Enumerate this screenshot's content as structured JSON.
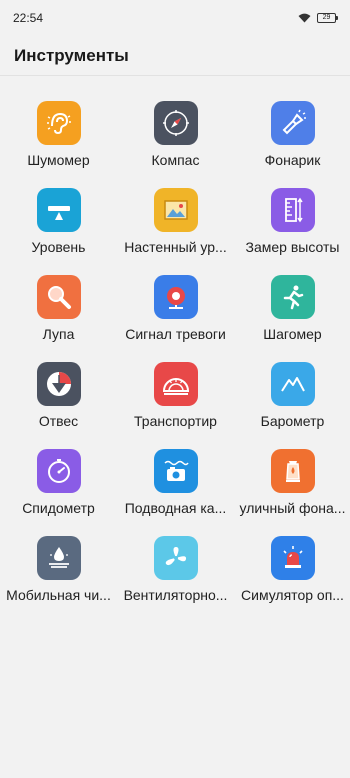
{
  "status_bar": {
    "time": "22:54",
    "battery": "29"
  },
  "header": {
    "title": "Инструменты"
  },
  "tools": [
    {
      "label": "Шумомер",
      "icon": "noise-meter-icon",
      "color": "#f5a020"
    },
    {
      "label": "Компас",
      "icon": "compass-icon",
      "color": "#4b5260"
    },
    {
      "label": "Фонарик",
      "icon": "flashlight-icon",
      "color": "#4f7fe8"
    },
    {
      "label": "Уровень",
      "icon": "level-icon",
      "color": "#1aa3d6"
    },
    {
      "label": "Настенный ур...",
      "icon": "wall-level-icon",
      "color": "#f0b428"
    },
    {
      "label": "Замер высоты",
      "icon": "height-measure-icon",
      "color": "#8a5ce6"
    },
    {
      "label": "Лупа",
      "icon": "magnifier-icon",
      "color": "#f07040"
    },
    {
      "label": "Сигнал тревоги",
      "icon": "alarm-icon",
      "color": "#3a7de8"
    },
    {
      "label": "Шагомер",
      "icon": "pedometer-icon",
      "color": "#2fb59c"
    },
    {
      "label": "Отвес",
      "icon": "plumb-bob-icon",
      "color": "#4b5260"
    },
    {
      "label": "Транспортир",
      "icon": "protractor-icon",
      "color": "#e84848"
    },
    {
      "label": "Барометр",
      "icon": "barometer-icon",
      "color": "#3aa8e8"
    },
    {
      "label": "Спидометр",
      "icon": "speedometer-icon",
      "color": "#8a5ce6"
    },
    {
      "label": "Подводная ка...",
      "icon": "underwater-camera-icon",
      "color": "#1f90e0"
    },
    {
      "label": "уличный фона...",
      "icon": "street-lantern-icon",
      "color": "#f07030"
    },
    {
      "label": "Мобильная чи...",
      "icon": "mobile-cleaner-icon",
      "color": "#5a6a80"
    },
    {
      "label": "Вентиляторно...",
      "icon": "fan-icon",
      "color": "#5cc8e8"
    },
    {
      "label": "Симулятор оп...",
      "icon": "alarm-siren-icon",
      "color": "#2f80e8"
    }
  ]
}
